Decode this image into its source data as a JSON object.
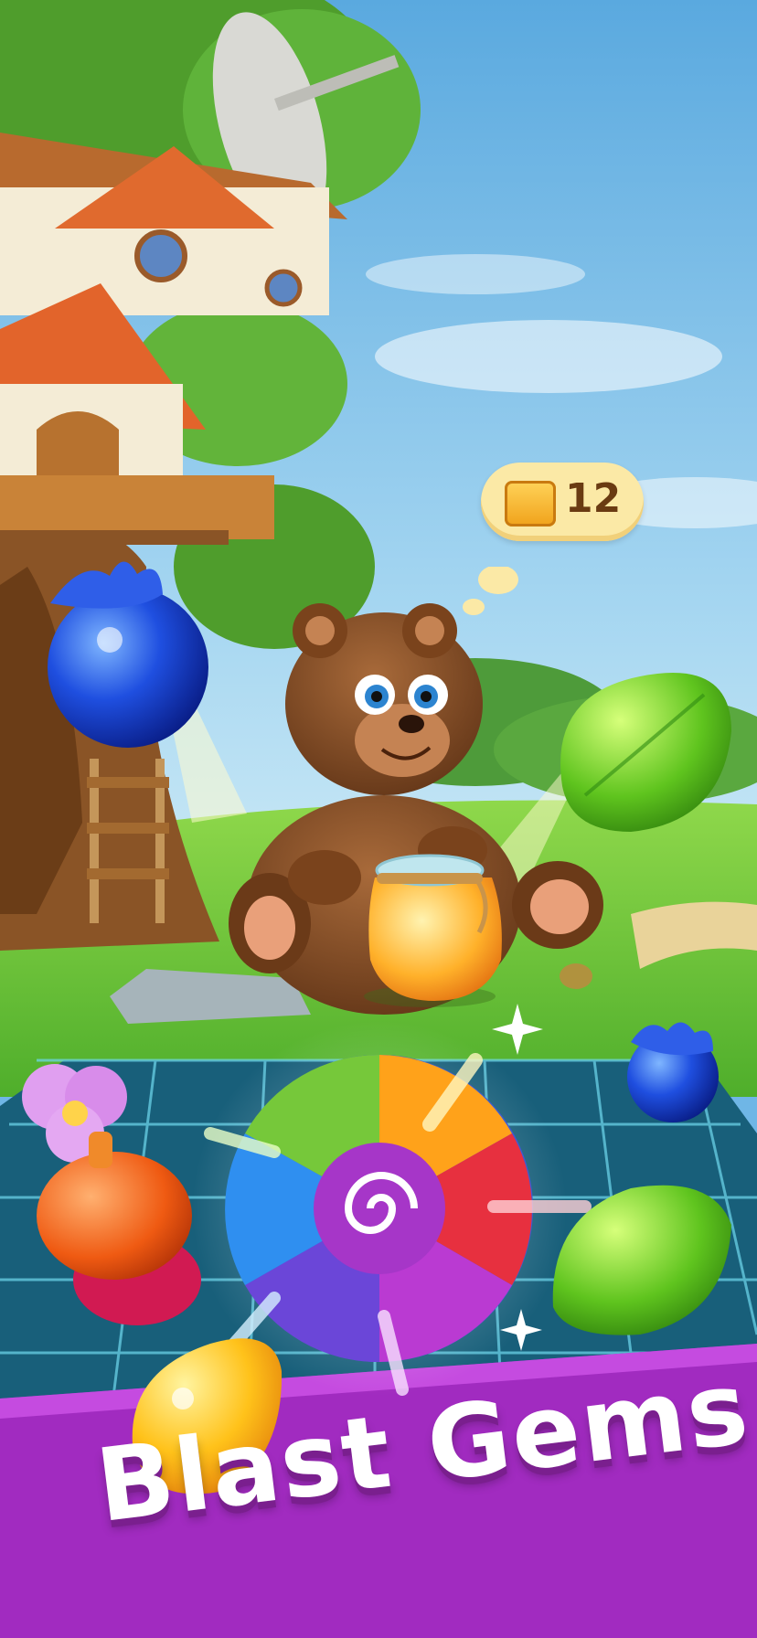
{
  "goal": {
    "icon": "honeycomb-icon",
    "count": "12"
  },
  "banner": {
    "title": "Blast Gems",
    "color": "#9b2ab5"
  },
  "gems": [
    {
      "name": "blueberry-gem",
      "icon": "blueberry-icon"
    },
    {
      "name": "green-leaf-gem",
      "icon": "leaf-icon"
    },
    {
      "name": "small-blueberry-gem",
      "icon": "blueberry-icon"
    },
    {
      "name": "acorn-gem",
      "icon": "acorn-icon"
    },
    {
      "name": "rainbow-bomb",
      "icon": "rainbow-bomb-icon"
    },
    {
      "name": "green-leaf-gem-lower",
      "icon": "leaf-icon"
    },
    {
      "name": "amber-gem",
      "icon": "amber-drop-icon"
    },
    {
      "name": "flower-gem",
      "icon": "flower-icon"
    }
  ],
  "colors": {
    "sky": "#7ec3ec",
    "grass": "#7fcf3e",
    "board_tile": "#1f6f8c",
    "banner": "#9b2ab5"
  }
}
